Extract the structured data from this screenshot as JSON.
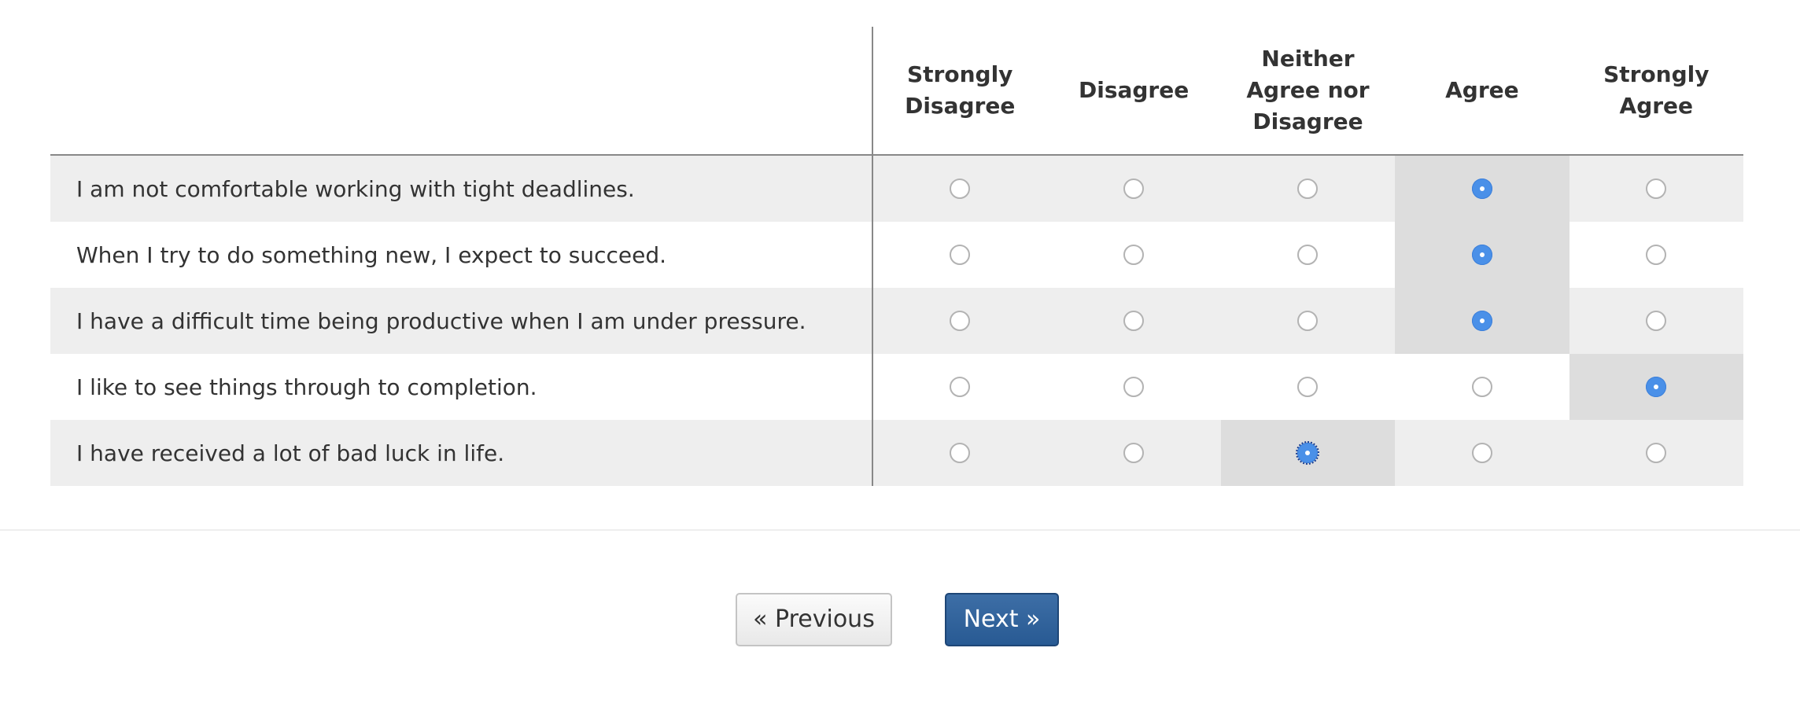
{
  "columns": {
    "c1": "Strongly Disagree",
    "c2": "Disagree",
    "c3": "Neither Agree nor Disagree",
    "c4": "Agree",
    "c5": "Strongly Agree"
  },
  "rows": [
    {
      "statement": "I am not comfortable working with tight deadlines.",
      "selected": "Agree"
    },
    {
      "statement": "When I try to do something new, I expect to succeed.",
      "selected": "Agree"
    },
    {
      "statement": "I have a difficult time being productive when I am under pressure.",
      "selected": "Agree"
    },
    {
      "statement": "I like to see things through to completion.",
      "selected": "Strongly Agree"
    },
    {
      "statement": "I have received a lot of bad luck in life.",
      "selected": "Neither Agree nor Disagree"
    }
  ],
  "navigation": {
    "previous_label": "« Previous",
    "next_label": "Next »"
  },
  "colors": {
    "accent": "#4a90e8",
    "next_button": "#2f6299",
    "row_shade": "#eeeeee",
    "selected_cell": "#dddddd"
  },
  "icons": {
    "radio": "radio-button-icon"
  }
}
